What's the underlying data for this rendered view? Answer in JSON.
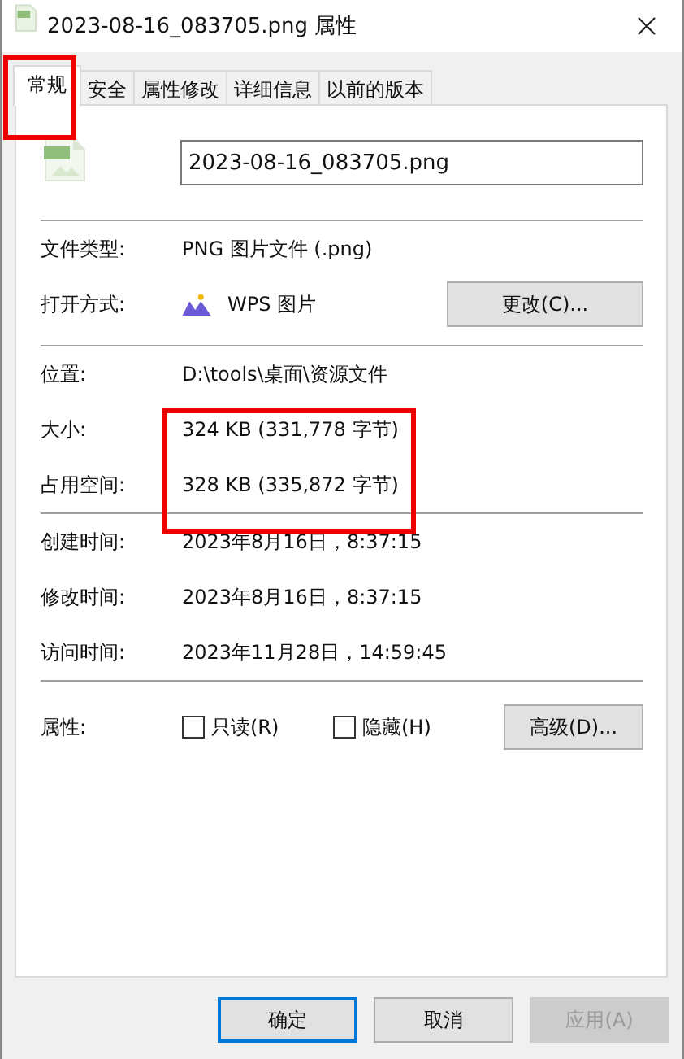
{
  "window": {
    "title": "2023-08-16_083705.png 属性"
  },
  "tabs": [
    {
      "label": "常规",
      "selected": true,
      "highlighted": true
    },
    {
      "label": "安全",
      "selected": false,
      "highlighted": false
    },
    {
      "label": "属性修改",
      "selected": false,
      "highlighted": false
    },
    {
      "label": "详细信息",
      "selected": false,
      "highlighted": false
    },
    {
      "label": "以前的版本",
      "selected": false,
      "highlighted": false
    }
  ],
  "file_name": {
    "value": "2023-08-16_083705.png"
  },
  "file_type": {
    "label": "文件类型:",
    "value": "PNG 图片文件 (.png)"
  },
  "opens_with": {
    "label": "打开方式:",
    "value": "WPS 图片",
    "button": "更改(C)..."
  },
  "location": {
    "label": "位置:",
    "value": "D:\\tools\\桌面\\资源文件"
  },
  "size_group": {
    "highlighted": true,
    "rows": [
      {
        "label": "大小:",
        "value": "324 KB (331,778 字节)"
      },
      {
        "label": "占用空间:",
        "value": "328 KB (335,872 字节)"
      }
    ]
  },
  "times": [
    {
      "label": "创建时间:",
      "value": "2023年8月16日，8:37:15"
    },
    {
      "label": "修改时间:",
      "value": "2023年8月16日，8:37:15"
    },
    {
      "label": "访问时间:",
      "value": "2023年11月28日，14:59:45"
    }
  ],
  "attributes": {
    "label": "属性:",
    "checkboxes": [
      {
        "label": "只读(R)",
        "checked": false
      },
      {
        "label": "隐藏(H)",
        "checked": false
      }
    ],
    "button": "高级(D)..."
  },
  "buttons": [
    {
      "label": "确定",
      "default": true,
      "disabled": false
    },
    {
      "label": "取消",
      "default": false,
      "disabled": false
    },
    {
      "label": "应用(A)",
      "default": false,
      "disabled": true
    }
  ]
}
